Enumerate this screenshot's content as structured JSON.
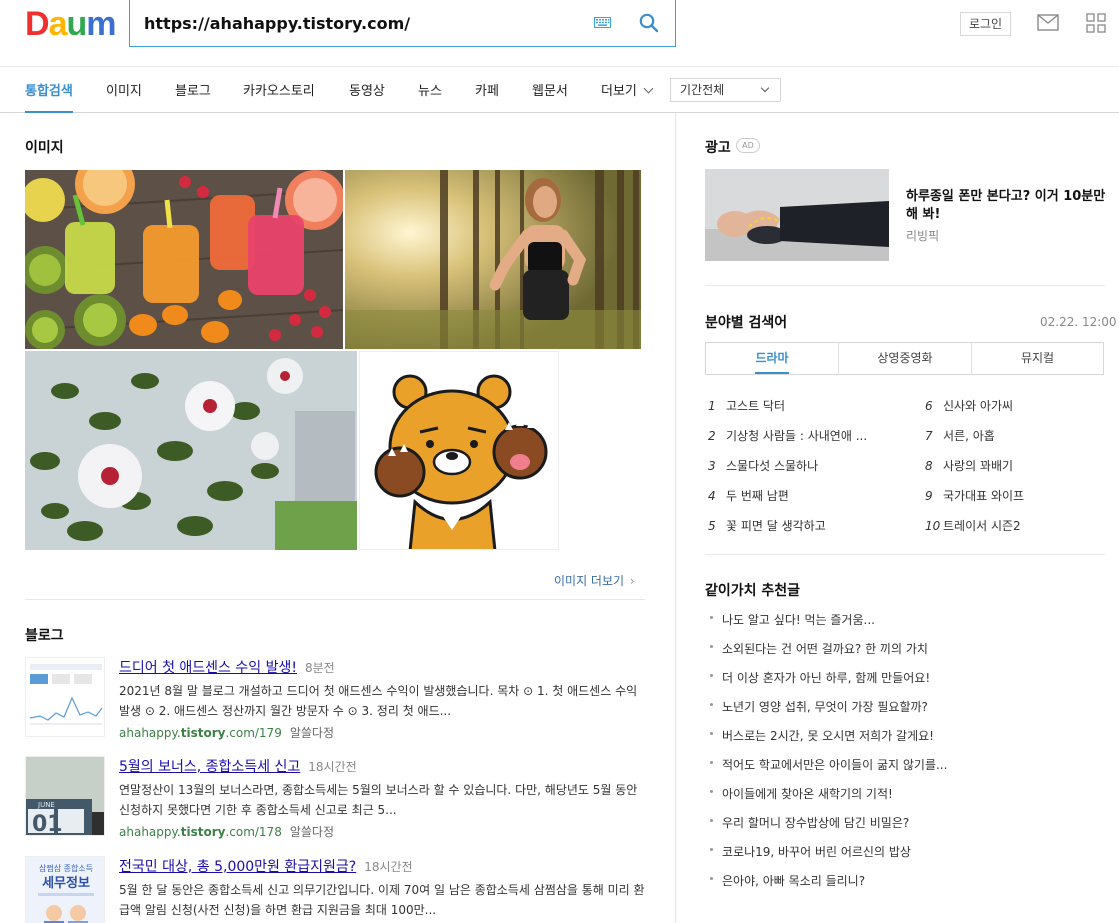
{
  "header": {
    "logo_letters": [
      "D",
      "a",
      "u",
      "m"
    ],
    "logo_colors": [
      "#f0302e",
      "#ffb400",
      "#2fa84f",
      "#3d6ed1"
    ],
    "search_value": "https://ahahappy.tistory.com/",
    "login_label": "로그인",
    "icons": [
      "keyboard-icon",
      "search-icon",
      "mail-icon",
      "app-grid-icon"
    ]
  },
  "tabs": {
    "items": [
      {
        "label": "통합검색",
        "active": true
      },
      {
        "label": "이미지"
      },
      {
        "label": "블로그"
      },
      {
        "label": "카카오스토리"
      },
      {
        "label": "동영상"
      },
      {
        "label": "뉴스"
      },
      {
        "label": "카페"
      },
      {
        "label": "웹문서"
      },
      {
        "label": "더보기"
      }
    ],
    "period": "기간전체"
  },
  "images": {
    "title": "이미지",
    "more_label": "이미지 더보기"
  },
  "blog": {
    "title": "블로그",
    "items": [
      {
        "title": "드디어 첫 애드센스 수익 발생!",
        "time": "8분전",
        "desc": "2021년 8월 말 블로그 개설하고 드디어 첫 애드센스 수익이 발생했습니다. 목차 ⊙ 1. 첫 애드센스 수익 발생 ⊙ 2. 애드센스 정산까지 월간 방문자 수 ⊙ 3. 정리 첫 애드...",
        "src_prefix": "ahahappy.",
        "src_domain": "tistory",
        "src_suffix": ".com/179",
        "author": "알쓸다정"
      },
      {
        "title": "5월의 보너스, 종합소득세 신고",
        "time": "18시간전",
        "desc": "연말정산이 13월의 보너스라면, 종합소득세는 5월의 보너스라 할 수 있습니다. 다만, 해당년도 5월 동안 신청하지 못했다면 기한 후 종합소득세 신고로 최근 5...",
        "src_prefix": "ahahappy.",
        "src_domain": "tistory",
        "src_suffix": ".com/178",
        "author": "알쓸다정"
      },
      {
        "title": "전국민 대상, 총 5,000만원 환급지원금?",
        "time": "18시간전",
        "desc": "5월 한 달 동안은 종합소득세 신고 의무기간입니다. 이제 70여 일 남은 종합소득세 삼쩜삼을 통해 미리 환급액 알림 신청(사전 신청)을 하면 환급 지원금을 최대 100만...",
        "src_prefix": "",
        "src_domain": "",
        "src_suffix": "",
        "author": ""
      }
    ],
    "thumb_texts": {
      "june": "JUNE",
      "day": "01",
      "tax1": "삼쩜삼 종합소득",
      "tax2": "세무정보"
    }
  },
  "ad": {
    "title": "광고",
    "badge": "AD",
    "headline": "하루종일 폰만 본다고? 이거 10분만 해 봐!",
    "source": "리빙픽"
  },
  "category": {
    "title": "분야별 검색어",
    "date": "02.22. 12:00",
    "tabs": [
      {
        "label": "드라마",
        "active": true
      },
      {
        "label": "상영중영화"
      },
      {
        "label": "뮤지컬"
      }
    ],
    "left": [
      {
        "rank": "1",
        "text": "고스트 닥터"
      },
      {
        "rank": "2",
        "text": "기상청 사람들 : 사내연애 ..."
      },
      {
        "rank": "3",
        "text": "스물다섯 스물하나"
      },
      {
        "rank": "4",
        "text": "두 번째 남편"
      },
      {
        "rank": "5",
        "text": "꽃 피면 달 생각하고"
      }
    ],
    "right": [
      {
        "rank": "6",
        "text": "신사와 아가씨"
      },
      {
        "rank": "7",
        "text": "서른, 아홉"
      },
      {
        "rank": "8",
        "text": "사랑의 꽈배기"
      },
      {
        "rank": "9",
        "text": "국가대표 와이프"
      },
      {
        "rank": "10",
        "text": "트레이서 시즌2"
      }
    ]
  },
  "recommend": {
    "title": "같이가치 추천글",
    "items": [
      "나도 알고 싶다! 먹는 즐거움...",
      "소외된다는 건 어떤 걸까요? 한 끼의 가치",
      "더 이상 혼자가 아닌 하루, 함께 만들어요!",
      "노년기 영양 섭취, 무엇이 가장 필요할까?",
      "버스로는 2시간, 못 오시면 저희가 갈게요!",
      "적어도 학교에서만은 아이들이 굶지 않기를...",
      "아이들에게 찾아온 새학기의 기적!",
      "우리 할머니 장수밥상에 담긴 비밀은?",
      "코로나19, 바꾸어 버린 어르신의 밥상",
      "은아야, 아빠 목소리 들리니?"
    ]
  }
}
